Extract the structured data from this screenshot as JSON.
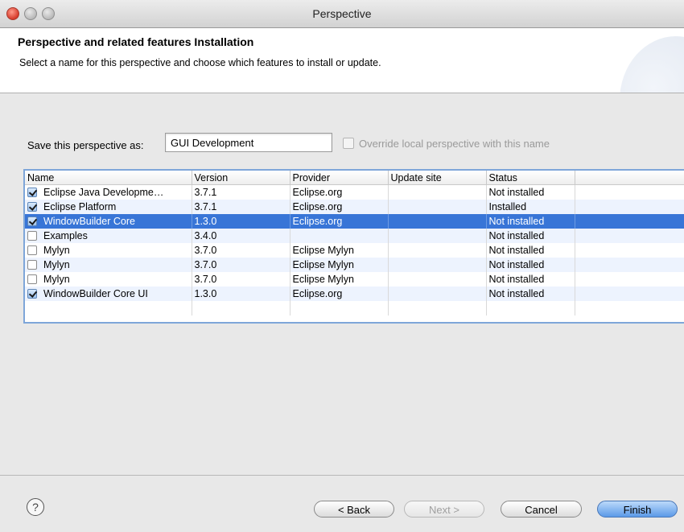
{
  "window": {
    "title": "Perspective"
  },
  "header": {
    "title": "Perspective and related features Installation",
    "description": "Select a name for this perspective and choose which features to install or update."
  },
  "form": {
    "save_label": "Save this perspective as:",
    "save_value": "GUI Development",
    "override_label": "Override local perspective with this name",
    "override_checked": false
  },
  "table": {
    "columns": [
      "Name",
      "Version",
      "Provider",
      "Update site",
      "Status"
    ],
    "rows": [
      {
        "checked": true,
        "name": "Eclipse Java Developme…",
        "version": "3.7.1",
        "provider": "Eclipse.org",
        "update_site": "",
        "status": "Not installed"
      },
      {
        "checked": true,
        "name": "Eclipse Platform",
        "version": "3.7.1",
        "provider": "Eclipse.org",
        "update_site": "",
        "status": "Installed"
      },
      {
        "checked": true,
        "name": "WindowBuilder Core",
        "version": "1.3.0",
        "provider": "Eclipse.org",
        "update_site": "",
        "status": "Not installed",
        "selected": true
      },
      {
        "checked": false,
        "name": "Examples",
        "version": "3.4.0",
        "provider": "",
        "update_site": "",
        "status": "Not installed"
      },
      {
        "checked": false,
        "name": "Mylyn",
        "version": "3.7.0",
        "provider": "Eclipse Mylyn",
        "update_site": "",
        "status": "Not installed"
      },
      {
        "checked": false,
        "name": "Mylyn",
        "version": "3.7.0",
        "provider": "Eclipse Mylyn",
        "update_site": "",
        "status": "Not installed"
      },
      {
        "checked": false,
        "name": "Mylyn",
        "version": "3.7.0",
        "provider": "Eclipse Mylyn",
        "update_site": "",
        "status": "Not installed"
      },
      {
        "checked": true,
        "name": "WindowBuilder Core UI",
        "version": "1.3.0",
        "provider": "Eclipse.org",
        "update_site": "",
        "status": "Not installed"
      }
    ]
  },
  "footer": {
    "help_icon": "?",
    "back": "< Back",
    "next": "Next >",
    "cancel": "Cancel",
    "finish": "Finish"
  },
  "colors": {
    "selection": "#3875d7",
    "alt_row": "#edf3fe",
    "table_border": "#7ea6d9"
  }
}
